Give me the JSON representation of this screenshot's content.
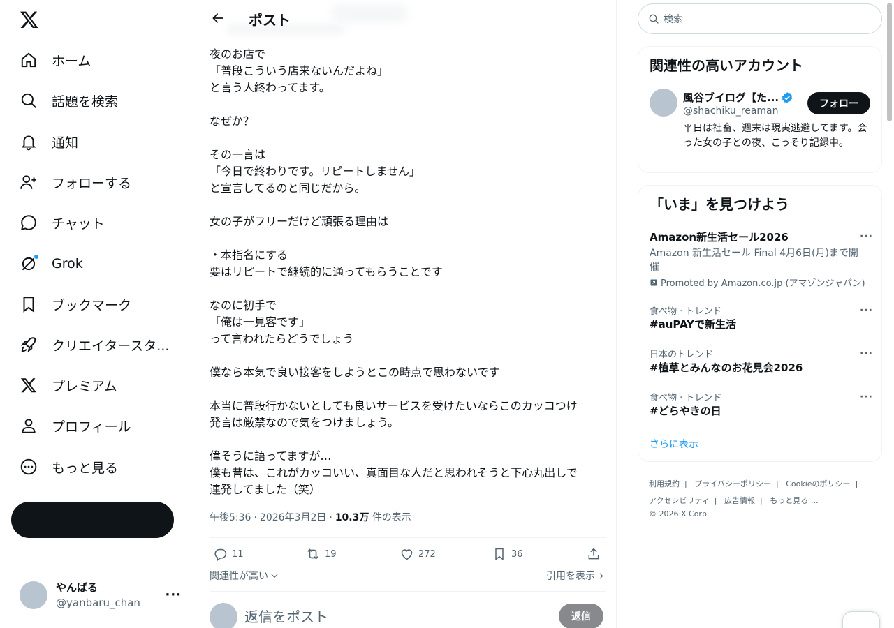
{
  "nav": {
    "items": [
      {
        "label": "ホーム",
        "icon": "home-icon"
      },
      {
        "label": "話題を検索",
        "icon": "search-icon"
      },
      {
        "label": "通知",
        "icon": "bell-icon"
      },
      {
        "label": "フォローする",
        "icon": "follow-icon"
      },
      {
        "label": "チャット",
        "icon": "chat-icon"
      },
      {
        "label": "Grok",
        "icon": "grok-icon"
      },
      {
        "label": "ブックマーク",
        "icon": "bookmark-icon"
      },
      {
        "label": "クリエイタースタ...",
        "icon": "rocket-icon"
      },
      {
        "label": "プレミアム",
        "icon": "x-icon"
      },
      {
        "label": "プロフィール",
        "icon": "profile-icon"
      },
      {
        "label": "もっと見る",
        "icon": "more-circle-icon"
      }
    ],
    "post_button": "",
    "me": {
      "name": "やんばる",
      "handle": "@yanbaru_chan"
    }
  },
  "header": {
    "title": "ポスト"
  },
  "post": {
    "lines": [
      "夜のお店で",
      "「普段こういう店来ないんだよね」",
      "と言う人終わってます。",
      "",
      "なぜか？",
      "",
      "その一言は",
      "「今日で終わりです。リピートしません」",
      "と宣言してるのと同じだから。",
      "",
      "女の子がフリーだけど頑張る理由は",
      "",
      "・本指名にする",
      "要はリピートで継続的に通ってもらうことです",
      "",
      "なのに初手で",
      "「俺は一見客です」",
      "って言われたらどうでしょう",
      "",
      "僕なら本気で良い接客をしようとこの時点で思わないです",
      "",
      "本当に普段行かないとしても良いサービスを受けたいならこのカッコつけ",
      "発言は厳禁なので気をつけましょう。",
      "",
      "偉そうに語ってますが…",
      "僕も昔は、これがカッコいい、真面目な人だと思われそうと下心丸出しで",
      "連発してました（笑）"
    ],
    "time": "午後5:36",
    "date": "2026年3月2日",
    "views": "10.3万",
    "views_label": "件の表示",
    "stats": {
      "replies": "11",
      "reposts": "19",
      "likes": "272",
      "bookmarks": "36"
    },
    "sort_label": "関連性が高い",
    "quotes_label": "引用を表示"
  },
  "reply": {
    "placeholder": "返信をポスト",
    "button": "返信"
  },
  "search": {
    "placeholder": "検索"
  },
  "related": {
    "title": "関連性の高いアカウント",
    "account": {
      "name": "風谷ブイログ【た...",
      "handle": "@shachiku_reaman",
      "bio": "平日は社畜、週末は現実逃避してます。会った女の子との夜、こっそり記録中。",
      "follow": "フォロー"
    }
  },
  "trends": {
    "title": "「いま」を見つけよう",
    "promoted": {
      "name": "Amazon新生活セール2026",
      "desc": "Amazon 新生活セール Final 4月6日(月)まで開催",
      "promo": "Promoted by Amazon.co.jp (アマゾンジャパン)"
    },
    "items": [
      {
        "cat": "食べ物 · トレンド",
        "name": "#auPAYで新生活"
      },
      {
        "cat": "日本のトレンド",
        "name": "#植草とみんなのお花見会2026"
      },
      {
        "cat": "食べ物 · トレンド",
        "name": "#どらやきの日"
      }
    ],
    "show_more": "さらに表示"
  },
  "footer": {
    "links": [
      "利用規約",
      "プライバシーポリシー",
      "Cookieのポリシー",
      "アクセシビリティ",
      "広告情報",
      "もっと見る …"
    ],
    "copyright": "© 2026 X Corp."
  },
  "colors": {
    "accent": "#1d9bf0",
    "dark": "#0f1419",
    "muted": "#536471"
  }
}
